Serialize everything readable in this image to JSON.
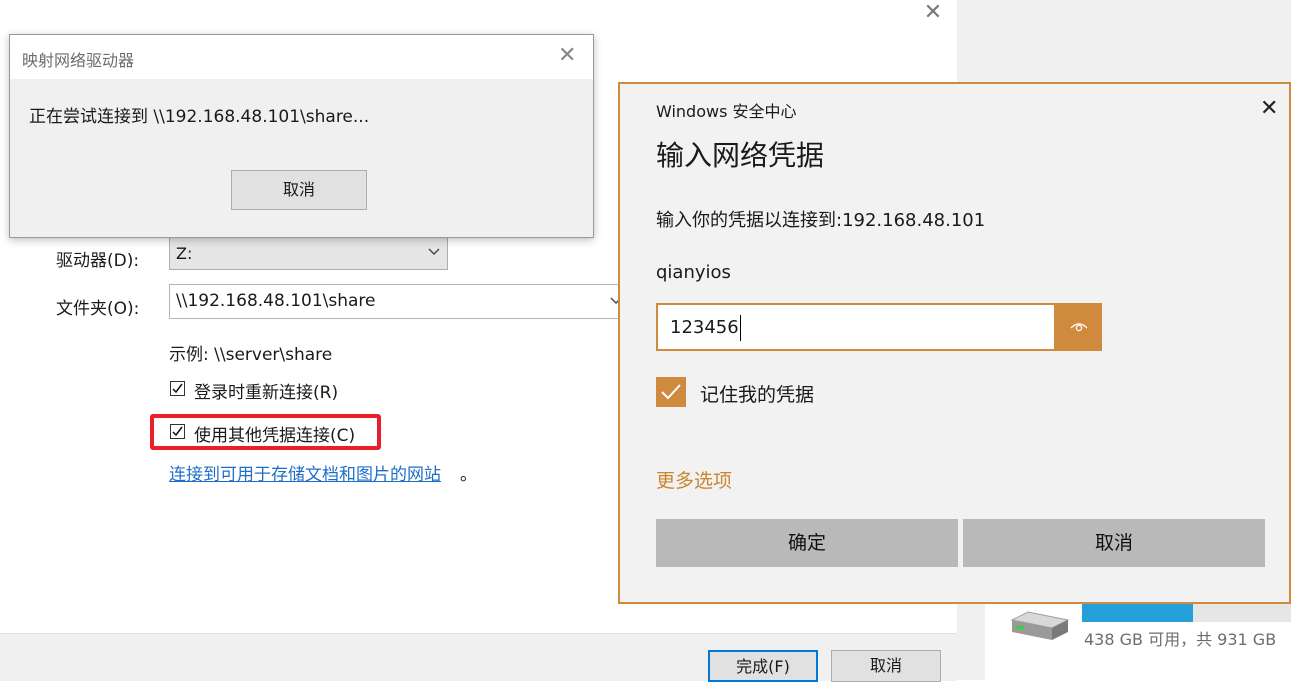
{
  "main_window": {
    "drive_label": "驱动器(D):",
    "drive_value": "Z:",
    "folder_label": "文件夹(O):",
    "folder_value": "\\\\192.168.48.101\\share",
    "example_text": "示例: \\\\server\\share",
    "reconnect_label": "登录时重新连接(R)",
    "reconnect_checked": true,
    "other_creds_label": "使用其他凭据连接(C)",
    "other_creds_checked": true,
    "site_link": "连接到可用于存储文档和图片的网站",
    "site_link_suffix": "。",
    "finish_button": "完成(F)",
    "cancel_button": "取消"
  },
  "connecting_dialog": {
    "title": "映射网络驱动器",
    "message": "正在尝试连接到 \\\\192.168.48.101\\share...",
    "cancel_button": "取消"
  },
  "security_dialog": {
    "app_name": "Windows 安全中心",
    "title": "输入网络凭据",
    "description": "输入你的凭据以连接到:192.168.48.101",
    "username": "qianyios",
    "password_value": "123456",
    "remember_label": "记住我的凭据",
    "remember_checked": true,
    "more_options": "更多选项",
    "ok_button": "确定",
    "cancel_button": "取消",
    "accent_color": "#d08a3e"
  },
  "explorer": {
    "drive_space_text": "438 GB 可用，共 931 GB",
    "drive_used_fraction": 0.53,
    "bar_color": "#26a0da"
  }
}
